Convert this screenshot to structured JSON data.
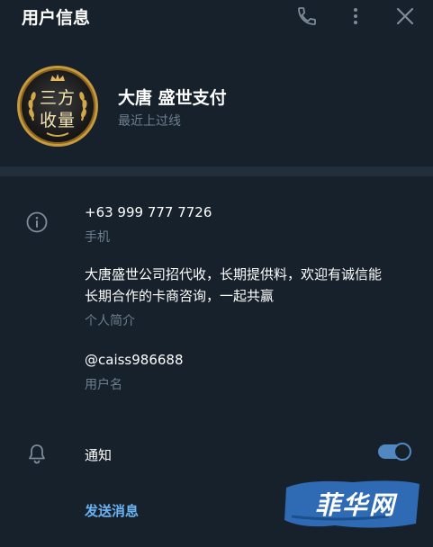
{
  "header": {
    "title": "用户信息",
    "icons": [
      "phone-icon",
      "more-vertical-icon",
      "close-icon"
    ]
  },
  "profile": {
    "avatar_line1": "三方",
    "avatar_line2": "收量",
    "name": "大唐 盛世支付",
    "status": "最近上过线"
  },
  "info": {
    "phone": "+63 999 777 7726",
    "phone_label": "手机",
    "bio_line1": "大唐盛世公司招代收，长期提供料，欢迎有诚信能",
    "bio_line2": "长期合作的卡商咨询，一起共赢",
    "bio_label": "个人简介",
    "username": "@caiss986688",
    "username_label": "用户名"
  },
  "notifications": {
    "label": "通知",
    "enabled": true
  },
  "actions": {
    "send_message": "发送消息"
  },
  "watermark": {
    "text": "菲华网"
  },
  "colors": {
    "background": "#17212b",
    "divider": "#232e3c",
    "accent": "#5288c1",
    "link": "#6ab2f2",
    "muted_text": "#6d7f8f"
  }
}
